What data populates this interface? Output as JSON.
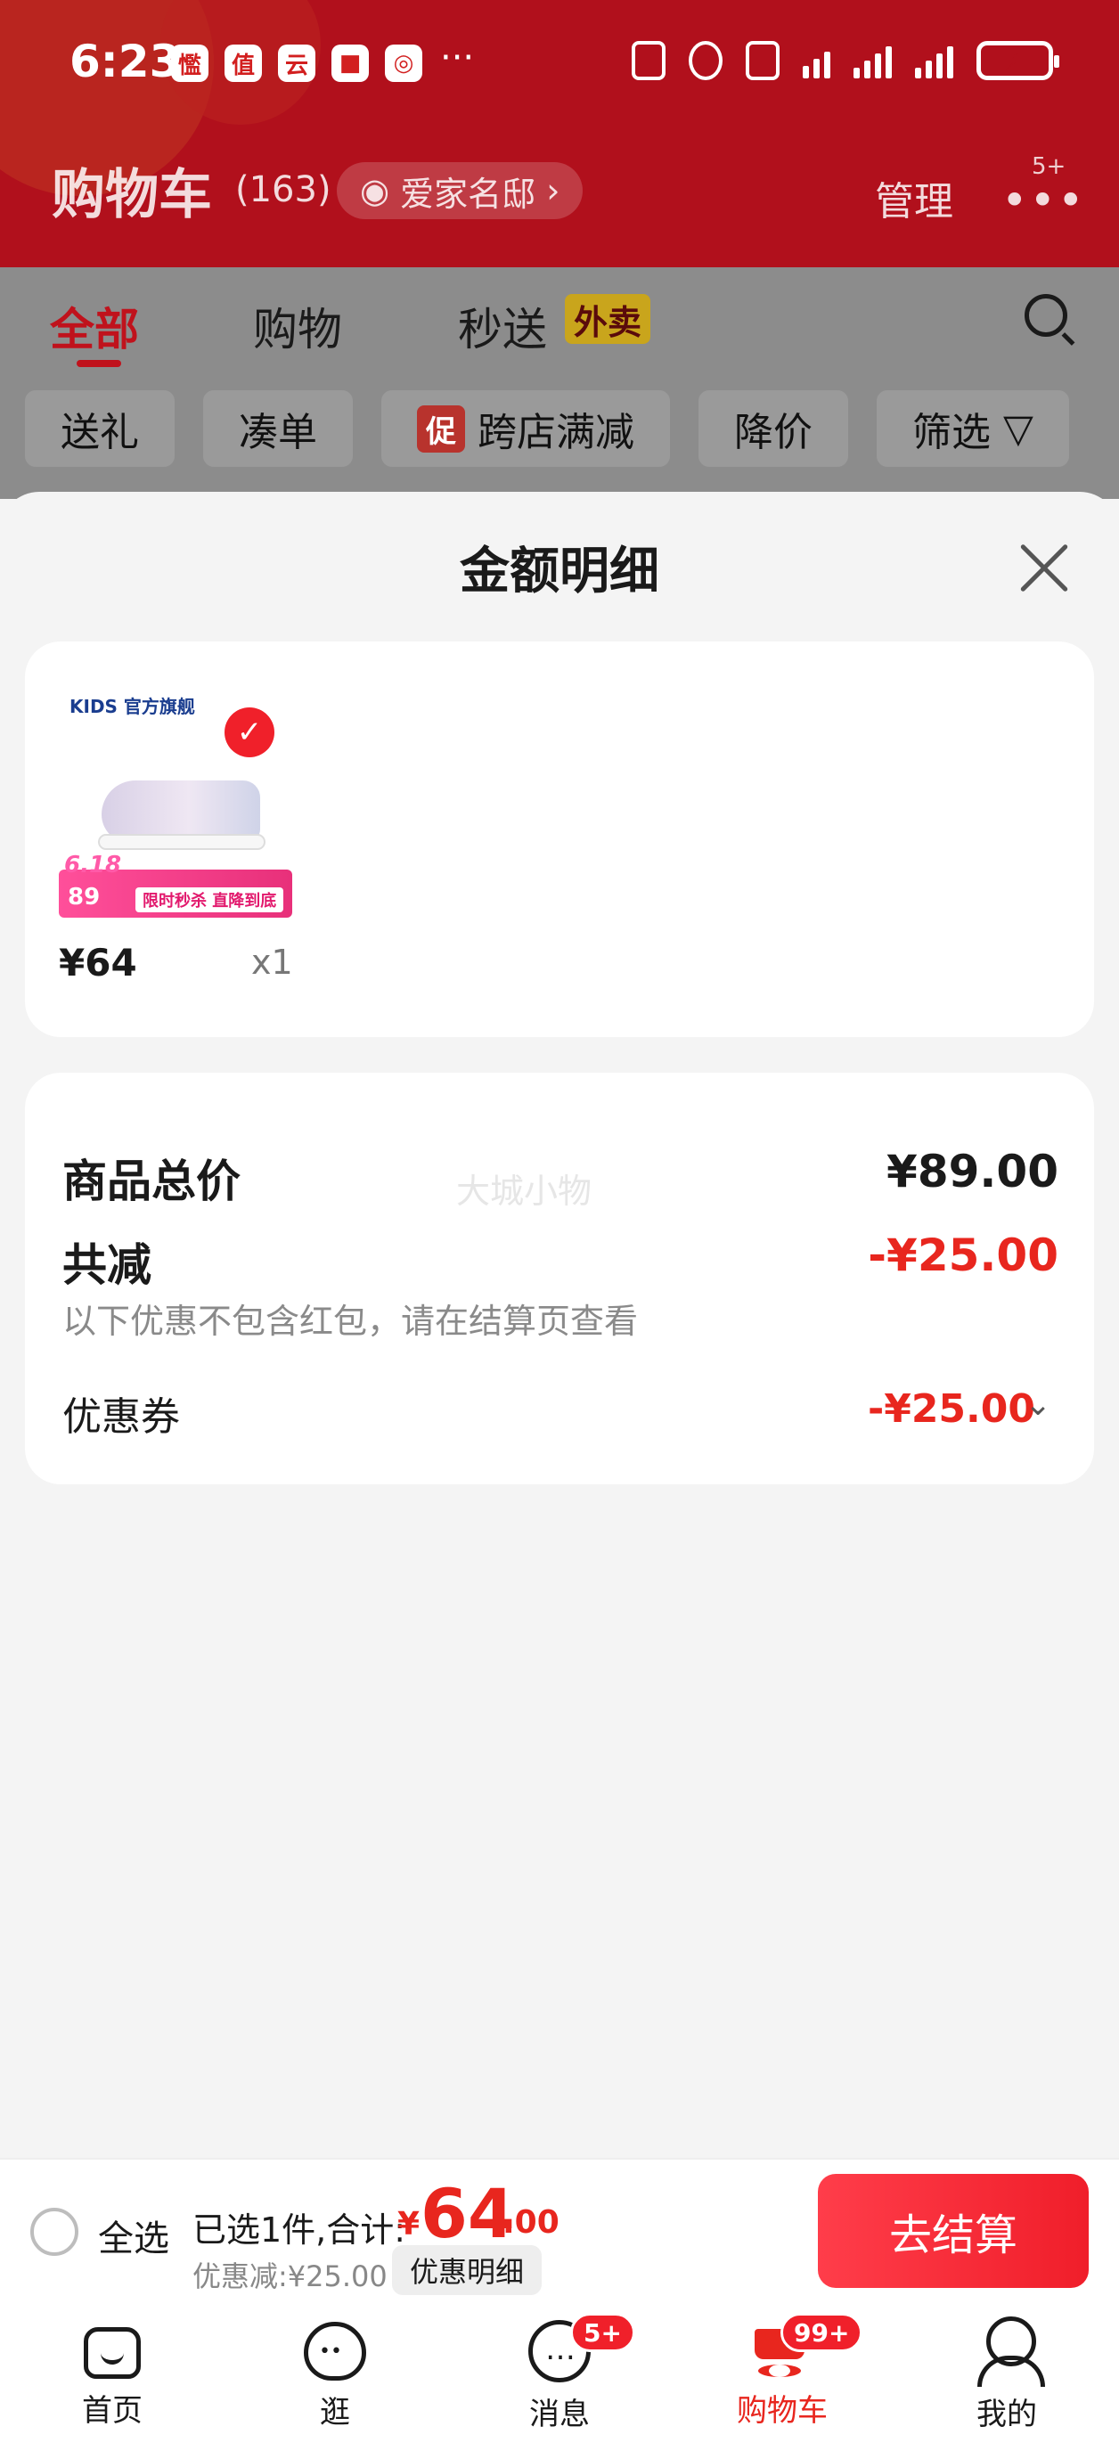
{
  "status_bar": {
    "time": "6:23",
    "apps": [
      "懢",
      "值",
      "云",
      "■",
      "◎"
    ],
    "more": "···"
  },
  "header": {
    "title": "购物车",
    "count": "(163)",
    "store_name": "爱家名邸",
    "manage": "管理",
    "more_badge": "5+"
  },
  "tabs": [
    {
      "label": "全部",
      "active": true
    },
    {
      "label": "购物",
      "active": false
    },
    {
      "label": "秒送",
      "active": false
    }
  ],
  "tab_badge": "外卖",
  "chips": [
    {
      "label": "送礼"
    },
    {
      "label": "凑单"
    },
    {
      "label": "跨店满减",
      "promo": "促"
    },
    {
      "label": "降价"
    },
    {
      "label": "筛选"
    }
  ],
  "sheet": {
    "title": "金额明细"
  },
  "item": {
    "brand": "KIDS 官方旗舰",
    "badge_618": "6.18",
    "banner_price": "89",
    "banner_tag": "限时秒杀 直降到底",
    "price": "¥64",
    "qty": "x1"
  },
  "summary": {
    "total_label": "商品总价",
    "total_value": "¥89.00",
    "reduce_label": "共减",
    "reduce_value": "-¥25.00",
    "note": "以下优惠不包含红包，请在结算页查看",
    "coupon_label": "优惠券",
    "coupon_value": "-¥25.00",
    "watermark": "大城小物"
  },
  "checkout": {
    "select_all": "全选",
    "selected_summary": "已选1件,合计:",
    "currency": "¥",
    "total_int": "64",
    "total_dec": ".00",
    "discount": "优惠减:¥25.00",
    "detail_button": "优惠明细",
    "checkout_button": "去结算"
  },
  "nav": [
    {
      "label": "首页"
    },
    {
      "label": "逛"
    },
    {
      "label": "消息",
      "badge": "5+"
    },
    {
      "label": "购物车",
      "badge": "99+",
      "active": true
    },
    {
      "label": "我的"
    }
  ],
  "colors": {
    "accent": "#e8261e",
    "header_bg": "#b1101c",
    "sheet_bg": "#f4f4f4"
  }
}
